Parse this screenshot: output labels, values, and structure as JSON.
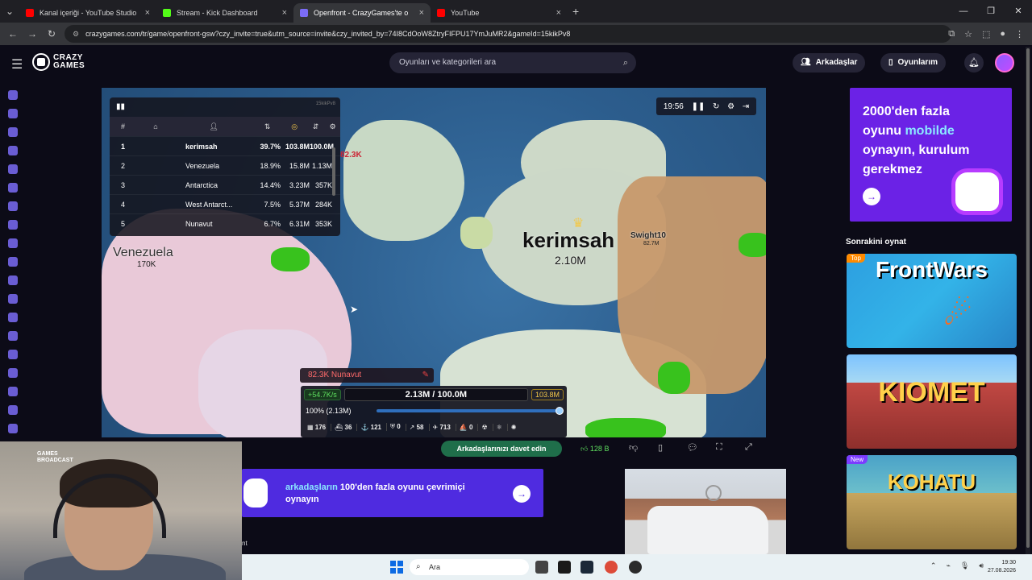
{
  "browser": {
    "tabs": [
      {
        "title": "Kanal içeriği - YouTube Studio",
        "color": "#ff0000",
        "active": false
      },
      {
        "title": "Stream - Kick Dashboard",
        "color": "#53fc18",
        "active": false
      },
      {
        "title": "Openfront - CrazyGames'te o",
        "color": "#7b6cf6",
        "active": true
      },
      {
        "title": "YouTube",
        "color": "#ff0000",
        "active": false
      }
    ],
    "url": "crazygames.com/tr/game/openfront-gsw?czy_invite=true&utm_source=invite&czy_invited_by=74I8CdOoW8ZtryFIFPU17YmJuMR2&gameId=15kikPv8"
  },
  "header": {
    "logo": "CRAZY GAMES",
    "search_placeholder": "Oyunları ve kategorileri ara",
    "friends": "Arkadaşlar",
    "mygames": "Oyunlarım"
  },
  "game": {
    "leaderboard": {
      "game_id": "15kikPv8",
      "headers": [
        "#"
      ],
      "rows": [
        {
          "rank": "1",
          "name": "kerimsah",
          "pct": "39.7%",
          "gold": "103.8M",
          "troops": "100.0M"
        },
        {
          "rank": "2",
          "name": "Venezuela",
          "pct": "18.9%",
          "gold": "15.8M",
          "troops": "1.13M"
        },
        {
          "rank": "3",
          "name": "Antarctica",
          "pct": "14.4%",
          "gold": "3.23M",
          "troops": "357K"
        },
        {
          "rank": "4",
          "name": "West Antarct...",
          "pct": "7.5%",
          "gold": "5.37M",
          "troops": "284K"
        },
        {
          "rank": "5",
          "name": "Nunavut",
          "pct": "6.7%",
          "gold": "6.31M",
          "troops": "353K"
        }
      ]
    },
    "timer": "19:56",
    "map_labels": {
      "kerimsah": "kerimsah",
      "kerimsah_troops": "2.10M",
      "venezuela": "Venezuela",
      "venezuela_troops": "170K",
      "swight": "Swight10",
      "swight_troops": "82.7M",
      "top_troops": "82.3K"
    },
    "attack_bar": "82.3K Nunavut",
    "hud": {
      "rate": "+54.7K/s",
      "troops": "2.13M / 100.0M",
      "gold": "103.8M",
      "ratio": "100% (2.13M)",
      "ratio_value": 1.0,
      "units": [
        "176",
        "36",
        "121",
        "0",
        "58",
        "713",
        "0"
      ]
    }
  },
  "below_bar": {
    "invite": "Arkadaşlarınızı davet edin",
    "likes": "128 B"
  },
  "promo": {
    "accent": "arkadaşların",
    "rest": " 100'den fazla oyunu çevrimiçi",
    "line2": "oynayın"
  },
  "right_ad": {
    "line1": "2000'den fazla",
    "line2a": "oyunu ",
    "line2b": "mobilde",
    "line3": "oynayın, kurulum",
    "line4": "gerekmez"
  },
  "next": {
    "title": "Sonrakini oynat",
    "games": [
      {
        "name": "FrontWars",
        "badge": "Top",
        "badge_color": "#ff8a00"
      },
      {
        "name": "KIOMET",
        "badge": "",
        "badge_color": ""
      },
      {
        "name": "KOHATU",
        "badge": "New",
        "badge_color": "#7b3cff"
      }
    ]
  },
  "webcam": {
    "brand_line1": "GAMES",
    "brand_line2": "BROADCAST",
    "side_text": "nt"
  },
  "taskbar": {
    "search": "Ara",
    "time": "19:30",
    "date": "27.08.2026"
  }
}
